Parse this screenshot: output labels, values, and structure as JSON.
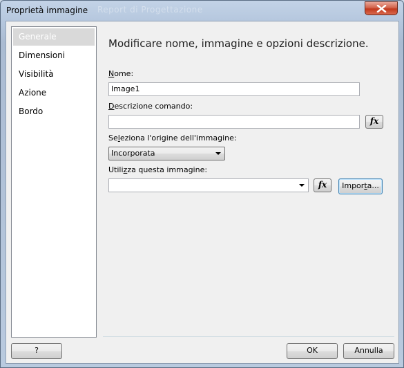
{
  "window": {
    "title": "Proprietà immagine",
    "background_title_ghost": "Report di Progettazione",
    "close_label": "×"
  },
  "nav": {
    "items": [
      {
        "label": "Generale",
        "selected": true
      },
      {
        "label": "Dimensioni",
        "selected": false
      },
      {
        "label": "Visibilità",
        "selected": false
      },
      {
        "label": "Azione",
        "selected": false
      },
      {
        "label": "Bordo",
        "selected": false
      }
    ]
  },
  "main": {
    "heading": "Modificare nome, immagine e opzioni descrizione.",
    "name_label_mnemonic": "N",
    "name_label_rest": "ome:",
    "name_value": "Image1",
    "tooltip_label_mnemonic": "D",
    "tooltip_label_rest": "escrizione comando:",
    "tooltip_value": "",
    "source_label_pre": "Se",
    "source_label_mnemonic": "l",
    "source_label_rest": "eziona l'origine dell'immagine:",
    "source_value": "Incorporata",
    "image_label_pre": "Utili",
    "image_label_mnemonic": "z",
    "image_label_rest": "za questa immagine:",
    "image_value": "",
    "fx_label": "fx",
    "import_pre": "Impor",
    "import_mnemonic": "t",
    "import_rest": "a..."
  },
  "footer": {
    "help_label": "?",
    "ok_label": "OK",
    "cancel_label": "Annulla"
  },
  "colors": {
    "selected_nav_bg": "#d9d9d9",
    "dialog_bg": "#f0f0f0",
    "close_button": "#c2391d"
  }
}
